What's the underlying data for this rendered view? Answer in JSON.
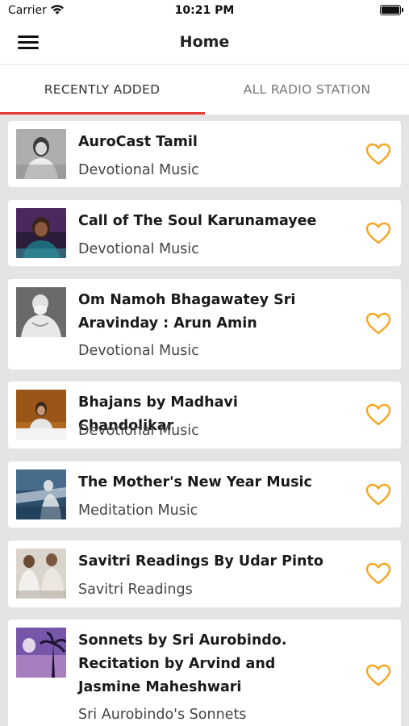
{
  "status": {
    "carrier": "Carrier",
    "time": "10:21 PM"
  },
  "nav": {
    "title": "Home"
  },
  "tabs": [
    {
      "label": "RECENTLY ADDED",
      "active": true
    },
    {
      "label": "ALL RADIO STATION",
      "active": false
    }
  ],
  "colors": {
    "accent": "#e53935",
    "heart": "#f5a623"
  },
  "items": [
    {
      "title": "AuroCast Tamil",
      "category": "Devotional Music",
      "icon": "heart-outline-icon"
    },
    {
      "title": "Call of The Soul Karunamayee",
      "category": "Devotional Music",
      "icon": "heart-outline-icon"
    },
    {
      "title": "Om Namoh Bhagawatey Sri Aravinday : Arun Amin",
      "category": "Devotional Music",
      "icon": "heart-outline-icon"
    },
    {
      "title": "Bhajans by Madhavi Chandolikar",
      "category": "Devotional Music",
      "icon": "heart-outline-icon"
    },
    {
      "title": "The Mother's New Year Music",
      "category": "Meditation Music",
      "icon": "heart-outline-icon"
    },
    {
      "title": "Savitri Readings By Udar Pinto",
      "category": "Savitri Readings",
      "icon": "heart-outline-icon"
    },
    {
      "title": "Sonnets by Sri Aurobindo. Recitation by Arvind and Jasmine Maheshwari",
      "category": "Sri Aurobindo's Sonnets",
      "icon": "heart-outline-icon"
    }
  ]
}
